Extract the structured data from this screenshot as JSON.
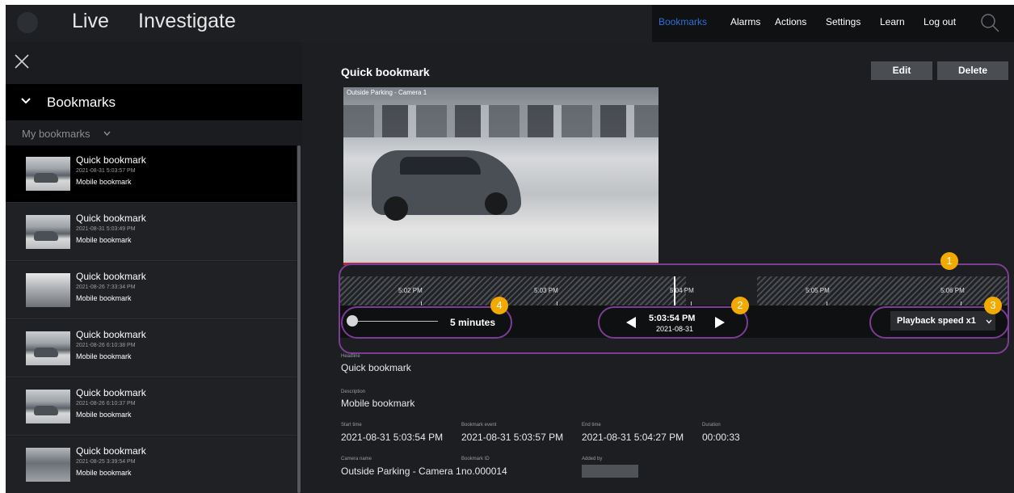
{
  "app": {
    "tabs": [
      "Live",
      "Investigate"
    ]
  },
  "nav": [
    "Bookmarks",
    "Alarms",
    "Actions",
    "Settings",
    "Learn",
    "Log out"
  ],
  "sidebar": {
    "header": "Bookmarks",
    "filter": "My bookmarks",
    "items": [
      {
        "name": "Quick bookmark",
        "date": "2021-08-31 5:03:57 PM",
        "desc": "Mobile bookmark"
      },
      {
        "name": "Quick bookmark",
        "date": "2021-08-31 5:03:49 PM",
        "desc": "Mobile bookmark"
      },
      {
        "name": "Quick bookmark",
        "date": "2021-08-26 7:33:34 PM",
        "desc": "Mobile bookmark"
      },
      {
        "name": "Quick bookmark",
        "date": "2021-08-26 6:10:38 PM",
        "desc": "Mobile bookmark"
      },
      {
        "name": "Quick bookmark",
        "date": "2021-08-26 6:10:37 PM",
        "desc": "Mobile bookmark"
      },
      {
        "name": "Quick bookmark",
        "date": "2021-08-25 3:39:54 PM",
        "desc": "Mobile bookmark"
      }
    ]
  },
  "main": {
    "title": "Quick bookmark",
    "edit_label": "Edit",
    "delete_label": "Delete",
    "camera_overlay": "Outside Parking - Camera 1"
  },
  "timeline": {
    "labels": [
      "5:02 PM",
      "5:03 PM",
      "5:04 PM",
      "5:05 PM",
      "5:06 PM"
    ],
    "zoom": "5 minutes",
    "current_time": "5:03:54 PM",
    "current_date": "2021-08-31",
    "speed": "Playback speed x1"
  },
  "callouts": [
    "1",
    "2",
    "3",
    "4"
  ],
  "details": {
    "headline_label": "Headline",
    "headline": "Quick bookmark",
    "description_label": "Description",
    "description": "Mobile bookmark",
    "start_label": "Start time",
    "start": "2021-08-31 5:03:54 PM",
    "event_label": "Bookmark event",
    "event": "2021-08-31 5:03:57 PM",
    "end_label": "End time",
    "end": "2021-08-31 5:04:27 PM",
    "duration_label": "Duration",
    "duration": "00:00:33",
    "camera_label": "Camera name",
    "camera": "Outside Parking - Camera 1",
    "id_label": "Bookmark ID",
    "id": "no.000014",
    "added_label": "Added by"
  },
  "colors": {
    "accent": "#2f6fd6",
    "callout_outline": "#7d3c95",
    "callout_badge": "#f2a900"
  }
}
